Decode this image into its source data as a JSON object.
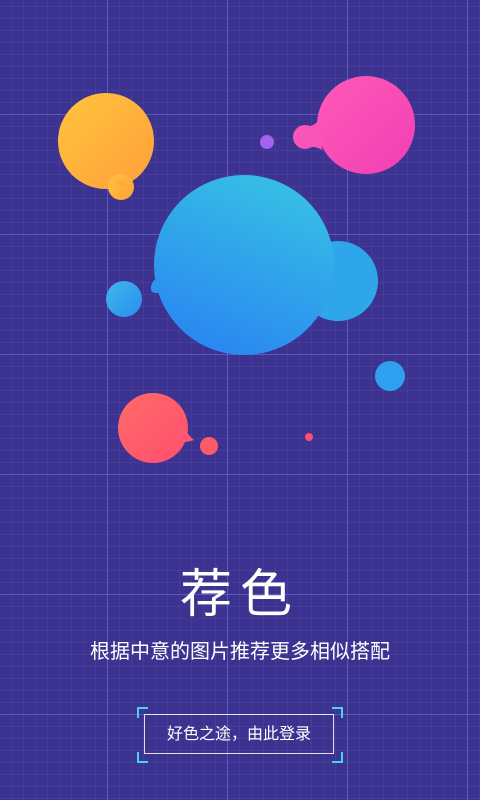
{
  "splash": {
    "title": "荐色",
    "subtitle": "根据中意的图片推荐更多相似搭配",
    "login_label": "好色之途，由此登录"
  },
  "colors": {
    "background": "#3c3290",
    "accent_corner": "#3fd6f2",
    "bubble_orange": "#ffb238",
    "bubble_pink": "#f64bb8",
    "bubble_blue": "#2e9cf0",
    "bubble_red": "#ff5a6a",
    "bubble_purple": "#a262f2"
  }
}
